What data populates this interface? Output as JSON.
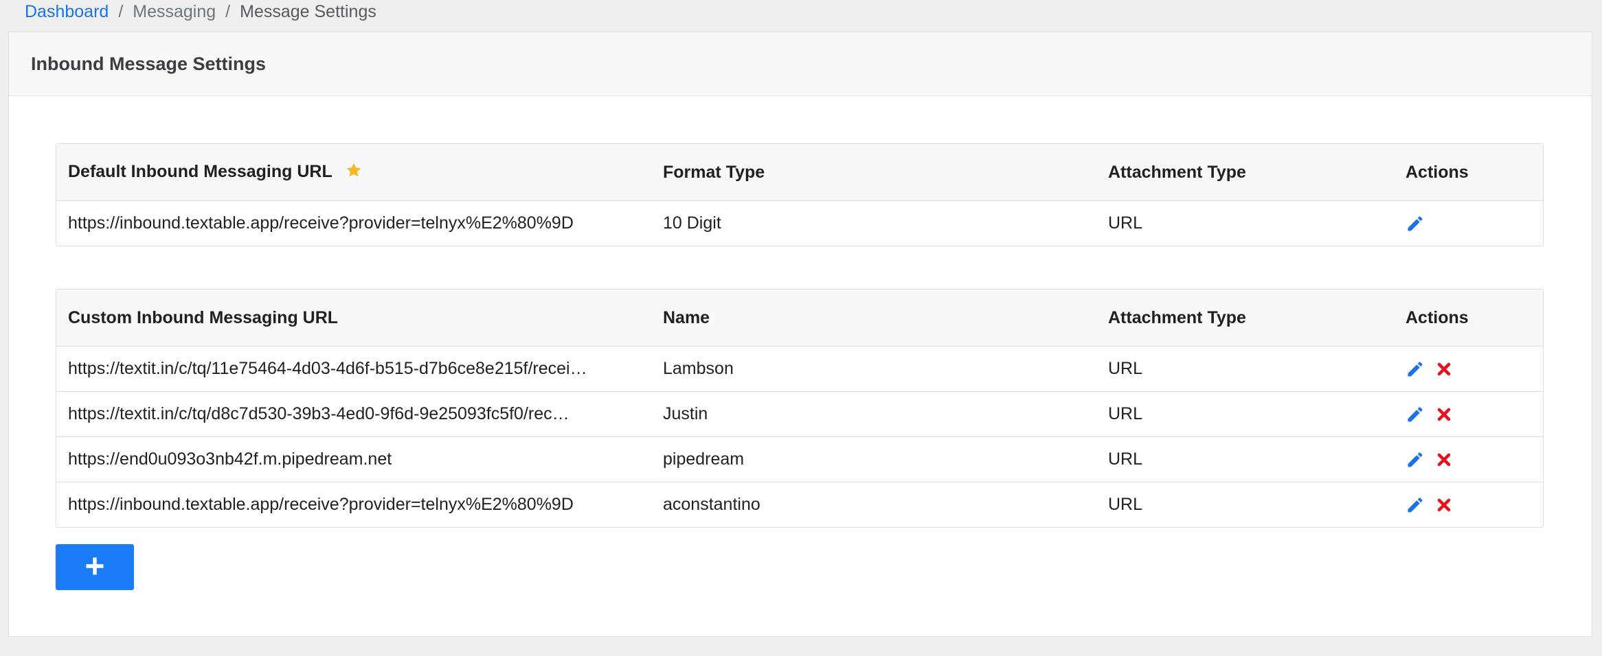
{
  "breadcrumb": {
    "items": [
      {
        "label": "Dashboard"
      },
      {
        "label": "Messaging"
      },
      {
        "label": "Message Settings"
      }
    ],
    "separator": "/"
  },
  "card": {
    "title": "Inbound Message Settings"
  },
  "default_table": {
    "headers": [
      "Default Inbound Messaging URL",
      "Format Type",
      "Attachment Type",
      "Actions"
    ],
    "rows": [
      {
        "url": "https://inbound.textable.app/receive?provider=telnyx%E2%80%9D",
        "format": "10 Digit",
        "attachment": "URL"
      }
    ]
  },
  "custom_table": {
    "headers": [
      "Custom Inbound Messaging URL",
      "Name",
      "Attachment Type",
      "Actions"
    ],
    "rows": [
      {
        "url": "https://textit.in/c/tq/11e75464-4d03-4d6f-b515-d7b6ce8e215f/recei…",
        "name": "Lambson",
        "attachment": "URL"
      },
      {
        "url": "https://textit.in/c/tq/d8c7d530-39b3-4ed0-9f6d-9e25093fc5f0/rec…",
        "name": "Justin",
        "attachment": "URL"
      },
      {
        "url": "https://end0u093o3nb42f.m.pipedream.net",
        "name": "pipedream",
        "attachment": "URL"
      },
      {
        "url": "https://inbound.textable.app/receive?provider=telnyx%E2%80%9D",
        "name": "aconstantino",
        "attachment": "URL"
      }
    ]
  },
  "icons": {
    "star": "star-icon",
    "edit": "pencil-icon",
    "delete": "close-icon",
    "add": "plus-icon"
  },
  "colors": {
    "link": "#1a73e8",
    "primary_button": "#1a7df5",
    "edit_icon": "#1a73e8",
    "delete_icon": "#e8101d",
    "star": "#f5b921"
  }
}
